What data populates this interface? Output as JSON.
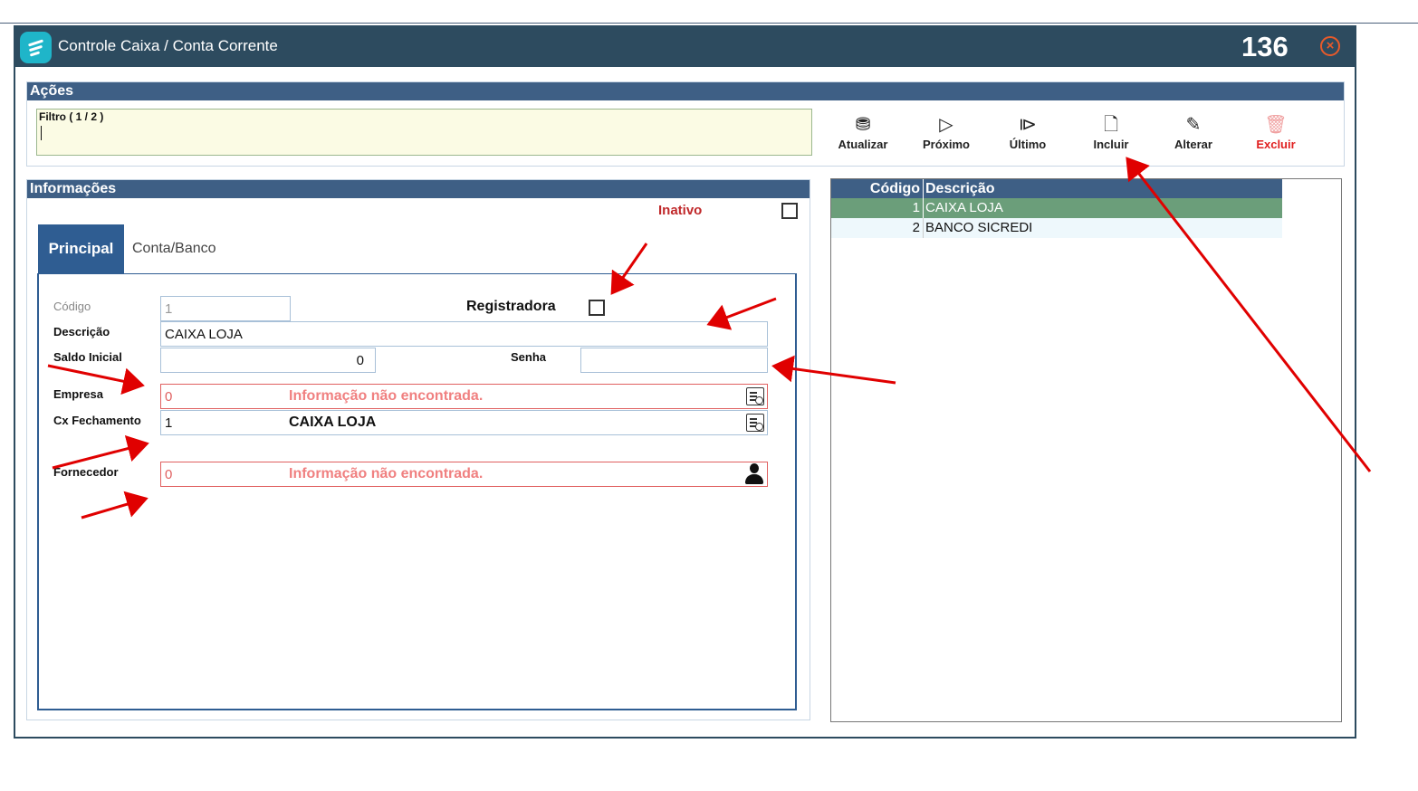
{
  "window": {
    "title": "Controle Caixa / Conta Corrente",
    "id": "136",
    "close_icon": "close-circle-icon"
  },
  "acoes": {
    "header": "Ações",
    "filter_label": "Filtro ( 1 / 2 )",
    "filter_value": "",
    "buttons": [
      {
        "label": "Atualizar",
        "icon": "refresh-icon"
      },
      {
        "label": "Próximo",
        "icon": "next-icon"
      },
      {
        "label": "Último",
        "icon": "last-icon"
      },
      {
        "label": "Incluir",
        "icon": "add-document-icon"
      },
      {
        "label": "Alterar",
        "icon": "edit-document-icon"
      },
      {
        "label": "Excluir",
        "icon": "trash-icon"
      }
    ]
  },
  "info": {
    "header": "Informações",
    "inativo_label": "Inativo",
    "tabs": [
      "Principal",
      "Conta/Banco"
    ],
    "fields": {
      "codigo_label": "Código",
      "codigo_value": "1",
      "registradora_label": "Registradora",
      "descricao_label": "Descrição",
      "descricao_value": "CAIXA LOJA",
      "saldo_label": "Saldo Inicial",
      "saldo_value": "0",
      "senha_label": "Senha",
      "senha_value": "",
      "empresa_label": "Empresa",
      "empresa_code": "0",
      "empresa_msg": "Informação não encontrada.",
      "cxfech_label": "Cx Fechamento",
      "cxfech_code": "1",
      "cxfech_desc": "CAIXA LOJA",
      "fornecedor_label": "Fornecedor",
      "fornecedor_code": "0",
      "fornecedor_msg": "Informação não encontrada."
    }
  },
  "grid": {
    "headers": [
      "Código",
      "Descrição"
    ],
    "rows": [
      {
        "codigo": "1",
        "descricao": "CAIXA LOJA",
        "selected": true
      },
      {
        "codigo": "2",
        "descricao": "BANCO SICREDI",
        "selected": false
      }
    ]
  },
  "colors": {
    "titlebar": "#2d4b5f",
    "section_header": "#3e5f85",
    "selected_row": "#6b9e7a",
    "annotation_arrow": "#e00000"
  }
}
